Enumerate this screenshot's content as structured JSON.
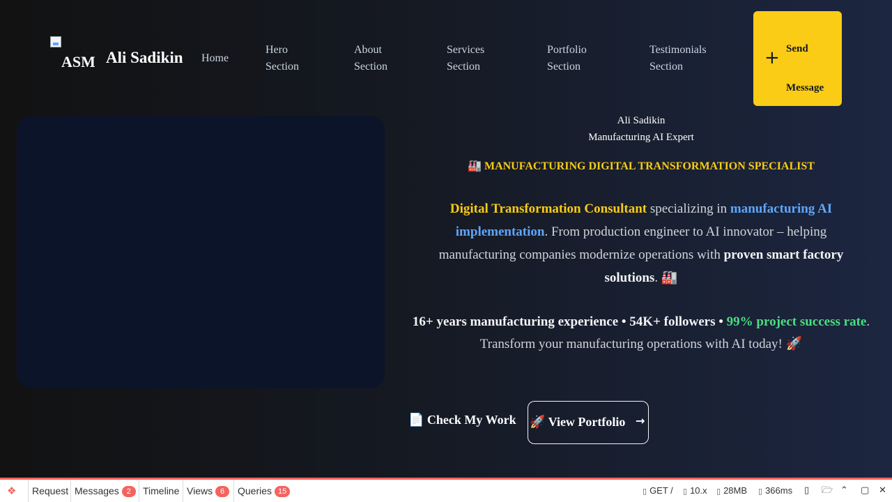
{
  "header": {
    "logo_alt": "ASM",
    "brand_name": "Ali Sadikin",
    "nav": [
      {
        "line1": "Home",
        "line2": ""
      },
      {
        "line1": "Hero",
        "line2": "Section"
      },
      {
        "line1": "About",
        "line2": "Section"
      },
      {
        "line1": "Services",
        "line2": "Section"
      },
      {
        "line1": "Portfolio",
        "line2": "Section"
      },
      {
        "line1": "Testimonials",
        "line2": "Section"
      }
    ],
    "cta": {
      "icon": "plus-icon",
      "line1": "Send",
      "line2": "Message"
    }
  },
  "hero": {
    "profile_name": "Ali Sadikin",
    "profile_role": "Manufacturing AI Expert",
    "specialist_icon": "🏭",
    "specialist_text": "MANUFACTURING DIGITAL TRANSFORMATION SPECIALIST",
    "description": {
      "highlight1": "Digital Transformation Consultant",
      "text1": " specializing in ",
      "highlight2": "manufacturing AI implementation",
      "text2": ". From production engineer to AI innovator – helping manufacturing companies modernize operations with ",
      "highlight3": "proven smart factory solutions",
      "text3": ". ",
      "emoji": "🏭"
    },
    "stats": {
      "bold": "16+ years manufacturing experience • 54K+ followers • ",
      "green": "99% project success rate",
      "text": ". Transform your manufacturing operations with AI today! ",
      "emoji": "🚀"
    },
    "buttons": {
      "check_icon": "📄",
      "check_label": "Check My Work",
      "view_icon": "🚀",
      "view_label": "View Portfolio",
      "view_arrow": "→"
    }
  },
  "debugbar": {
    "tabs": [
      {
        "label": "Request",
        "badge": ""
      },
      {
        "label": "Messages",
        "badge": "2"
      },
      {
        "label": "Timeline",
        "badge": ""
      },
      {
        "label": "Views",
        "badge": "6"
      },
      {
        "label": "Queries",
        "badge": "15"
      }
    ],
    "method": "GET /",
    "php_version": "10.x",
    "memory": "28MB",
    "duration": "366ms"
  },
  "colors": {
    "accent_yellow": "#facc15",
    "accent_blue": "#60a5fa",
    "accent_green": "#4ade80",
    "debug_red": "#f4645f"
  }
}
